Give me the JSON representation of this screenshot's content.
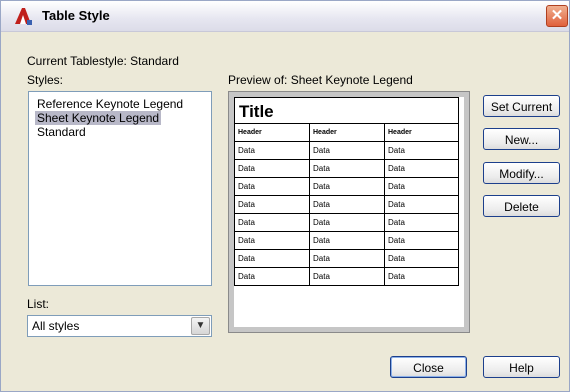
{
  "window": {
    "title": "Table Style",
    "close_glyph": "✕"
  },
  "current_tablestyle": "Current Tablestyle: Standard",
  "styles_label": "Styles:",
  "styles": [
    {
      "label": "Reference Keynote Legend",
      "selected": false
    },
    {
      "label": "Sheet Keynote Legend",
      "selected": true
    },
    {
      "label": "Standard",
      "selected": false
    }
  ],
  "preview_label": "Preview of: Sheet Keynote Legend",
  "preview": {
    "title": "Title",
    "headers": [
      "Header",
      "Header",
      "Header"
    ],
    "data_rows": [
      [
        "Data",
        "Data",
        "Data"
      ],
      [
        "Data",
        "Data",
        "Data"
      ],
      [
        "Data",
        "Data",
        "Data"
      ],
      [
        "Data",
        "Data",
        "Data"
      ],
      [
        "Data",
        "Data",
        "Data"
      ],
      [
        "Data",
        "Data",
        "Data"
      ],
      [
        "Data",
        "Data",
        "Data"
      ],
      [
        "Data",
        "Data",
        "Data"
      ]
    ]
  },
  "list_label": "List:",
  "list_value": "All styles",
  "buttons": {
    "set_current": "Set Current",
    "new": "New...",
    "modify": "Modify...",
    "delete": "Delete",
    "close": "Close",
    "help": "Help"
  },
  "colors": {
    "selection": "#b8b8c8",
    "dialog_bg": "#ece9d8",
    "close_button": "#e0603c"
  }
}
